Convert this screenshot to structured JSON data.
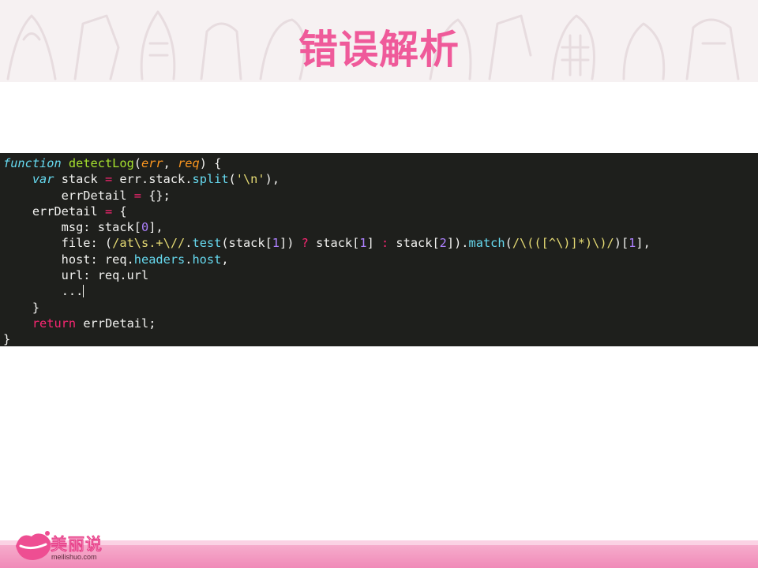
{
  "slide": {
    "title": "错误解析"
  },
  "code": {
    "fn_keyword": "function",
    "fn_name": "detectLog",
    "param_err": "err",
    "param_req": "req",
    "var_keyword": "var",
    "return_keyword": "return",
    "split_arg": "'\\n'",
    "zero": "0",
    "one": "1",
    "two": "2",
    "regex_test": "/at\\s.+\\//",
    "regex_match": "/\\(([^\\)]*)\\)/",
    "ellipsis": "..."
  },
  "brand": {
    "name": "美丽说",
    "url": "meilishuo.com"
  },
  "colors": {
    "title": "#ef5a9a",
    "code_bg": "#1e1f1c",
    "footer": "#f08ab8"
  }
}
